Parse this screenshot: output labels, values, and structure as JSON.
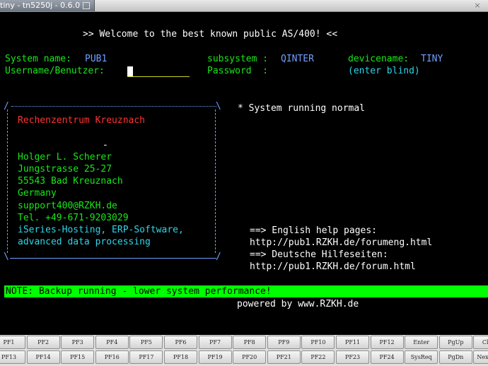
{
  "window": {
    "title": "tiny - tn5250j - 0.6.0",
    "close_glyph": "×"
  },
  "screen": {
    "welcome": ">> Welcome to the best known public AS/400! <<",
    "system_label": "System name:",
    "system_value": "PUB1",
    "subsystem_label": "subsystem :",
    "subsystem_value": "QINTER",
    "devicename_label": "devicename:",
    "devicename_value": "TINY",
    "username_label": "Username/Benutzer:",
    "password_label": "Password  :",
    "password_hint": "(enter blind)",
    "status": "* System running normal",
    "box": {
      "org": "Rechenzentrum Kreuznach",
      "dash": "-",
      "lines": [
        "Holger L. Scherer",
        "Jungstrasse 25-27",
        "55543 Bad Kreuznach",
        "Germany",
        "support400@RZKH.de",
        "Tel. +49-671-9203029",
        "iSeries-Hosting, ERP-Software,",
        "advanced data processing"
      ]
    },
    "help": {
      "en_label": "==> English help pages:",
      "en_url": "http://pub1.RZKH.de/forumeng.html",
      "de_label": "==> Deutsche Hilfeseiten:",
      "de_url": "http://pub1.RZKH.de/forum.html"
    },
    "note": "NOTE: Backup running - lower system performance!",
    "powered": "powered by www.RZKH.de"
  },
  "keypad": {
    "row1": [
      "PF1",
      "PF2",
      "PF3",
      "PF4",
      "PF5",
      "PF6",
      "PF7",
      "PF8",
      "PF9",
      "PF10",
      "PF11",
      "PF12",
      "Enter",
      "PgUp",
      "Clear"
    ],
    "row2": [
      "PF13",
      "PF14",
      "PF15",
      "PF16",
      "PF17",
      "PF18",
      "PF19",
      "PF20",
      "PF21",
      "PF22",
      "PF23",
      "PF24",
      "SysReq",
      "PgDn",
      "Next Pad"
    ]
  },
  "colors": {
    "green": "#17e817",
    "blue_field": "#6fa0ff",
    "cyan": "#2fd5e8",
    "red": "#ff3232",
    "note_bg": "#00ff00"
  }
}
